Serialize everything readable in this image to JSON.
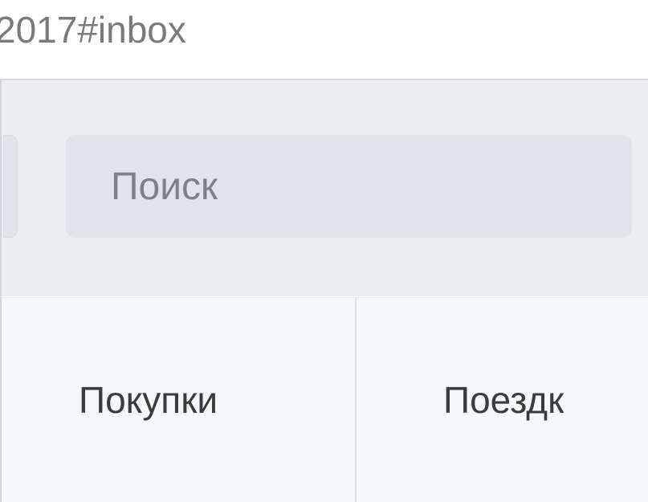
{
  "address_bar": {
    "url_fragment": "2017#inbox"
  },
  "toolbar": {
    "search": {
      "placeholder": "Поиск"
    }
  },
  "tabs": {
    "items": [
      {
        "label": "Покупки"
      },
      {
        "label": "Поездк"
      }
    ]
  }
}
